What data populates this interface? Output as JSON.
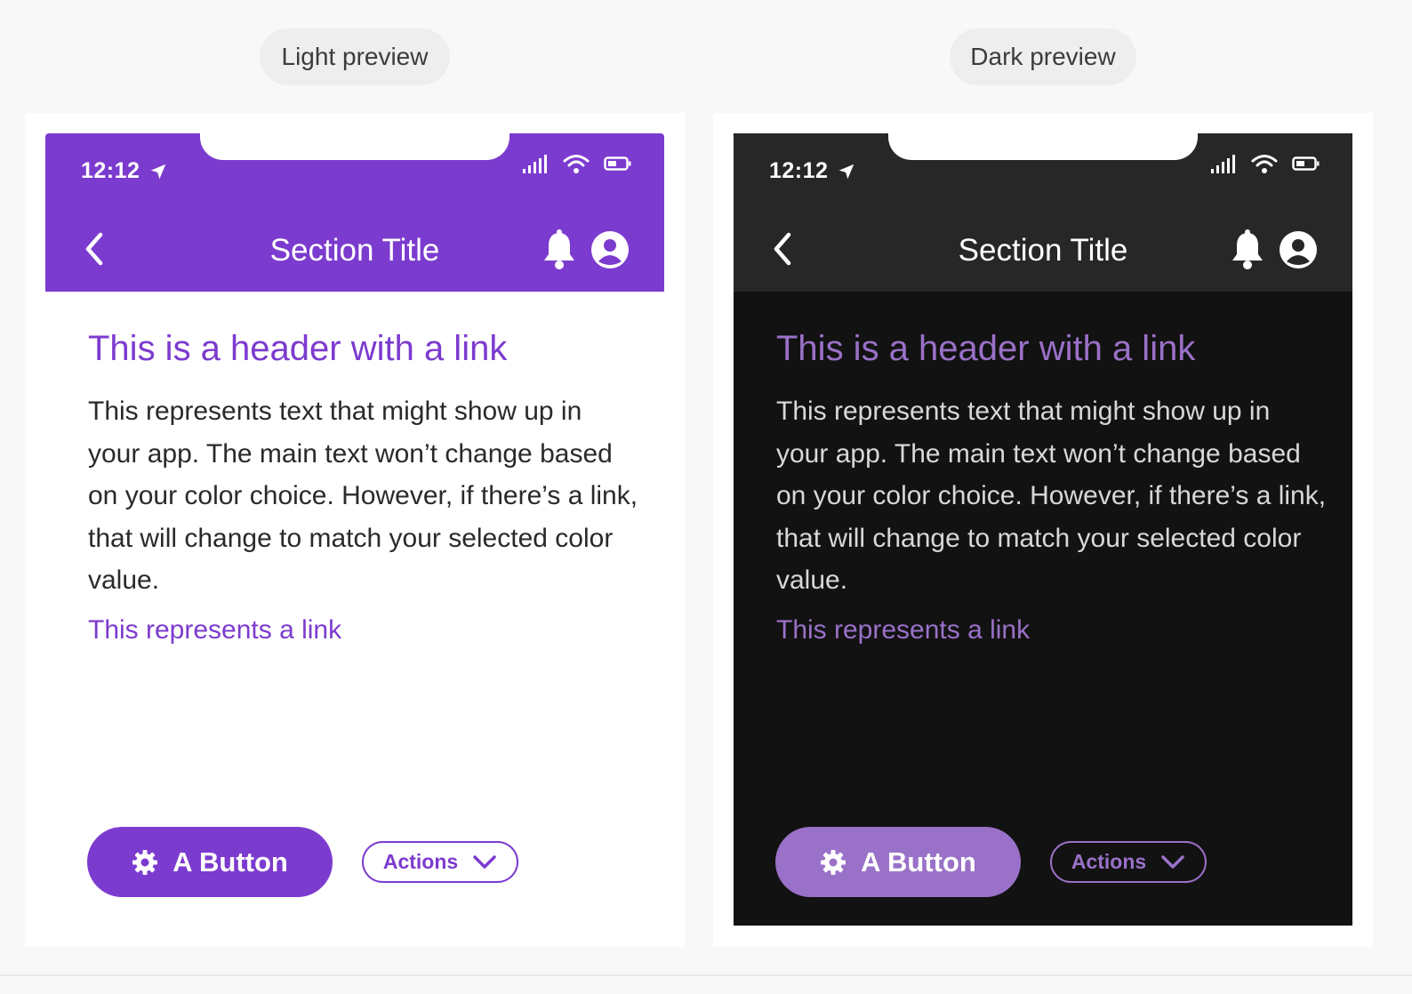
{
  "labels": {
    "light": "Light preview",
    "dark": "Dark preview"
  },
  "previews": {
    "light": {
      "status_time": "12:12",
      "section_title": "Section Title",
      "header_link": "This is a header with a link",
      "body_text": "This represents text that might show up in your app. The main text won’t change based on your color choice. However, if there’s a link, that will change to match your selected color value.",
      "link_text": "This represents a link",
      "primary_button": "A Button",
      "actions_button": "Actions"
    },
    "dark": {
      "status_time": "12:12",
      "section_title": "Section Title",
      "header_link": "This is a header with a link",
      "body_text": "This represents text that might show up in your app. The main text won’t change based on your color choice. However, if there’s a link, that will change to match your selected color value.",
      "link_text": "This represents a link",
      "primary_button": "A Button",
      "actions_button": "Actions"
    }
  },
  "icons": {
    "status": [
      "location-arrow-icon",
      "signal-icon",
      "wifi-icon",
      "battery-icon"
    ],
    "appbar": [
      "back-chevron-icon",
      "bell-icon",
      "user-avatar-icon"
    ],
    "buttons": [
      "gear-icon",
      "chevron-down-icon"
    ]
  },
  "colors": {
    "light_accent": "#7c3bcf",
    "dark_accent": "#9a71c8",
    "dark_appbar": "#272727",
    "dark_background": "#121212"
  }
}
